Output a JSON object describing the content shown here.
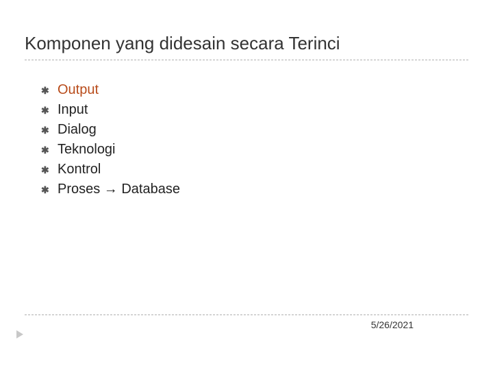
{
  "slide": {
    "title": "Komponen yang didesain secara Terinci",
    "items": [
      {
        "text": "Output",
        "highlight": true
      },
      {
        "text": "Input",
        "highlight": false
      },
      {
        "text": "Dialog",
        "highlight": false
      },
      {
        "text": "Teknologi",
        "highlight": false
      },
      {
        "text": "Kontrol",
        "highlight": false
      },
      {
        "text": "Proses → Database",
        "highlight": false
      }
    ],
    "date": "5/26/2021"
  }
}
